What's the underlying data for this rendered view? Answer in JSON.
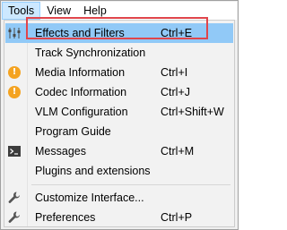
{
  "menubar": {
    "items": [
      {
        "label": "Tools"
      },
      {
        "label": "View"
      },
      {
        "label": "Help"
      }
    ]
  },
  "dropdown": {
    "items": [
      {
        "label": "Effects and Filters",
        "shortcut": "Ctrl+E",
        "icon": "equalizer-icon"
      },
      {
        "label": "Track Synchronization",
        "shortcut": "",
        "icon": ""
      },
      {
        "label": "Media Information",
        "shortcut": "Ctrl+I",
        "icon": "info-icon"
      },
      {
        "label": "Codec Information",
        "shortcut": "Ctrl+J",
        "icon": "info-icon"
      },
      {
        "label": "VLM Configuration",
        "shortcut": "Ctrl+Shift+W",
        "icon": ""
      },
      {
        "label": "Program Guide",
        "shortcut": "",
        "icon": ""
      },
      {
        "label": "Messages",
        "shortcut": "Ctrl+M",
        "icon": "terminal-icon"
      },
      {
        "label": "Plugins and extensions",
        "shortcut": "",
        "icon": ""
      },
      {
        "label": "Customize Interface...",
        "shortcut": "",
        "icon": "wrench-icon"
      },
      {
        "label": "Preferences",
        "shortcut": "Ctrl+P",
        "icon": "wrench-icon"
      }
    ]
  },
  "colors": {
    "highlight": "#91c9f7",
    "highlight_outline": "#e0454b",
    "info_icon": "#f4a321"
  }
}
